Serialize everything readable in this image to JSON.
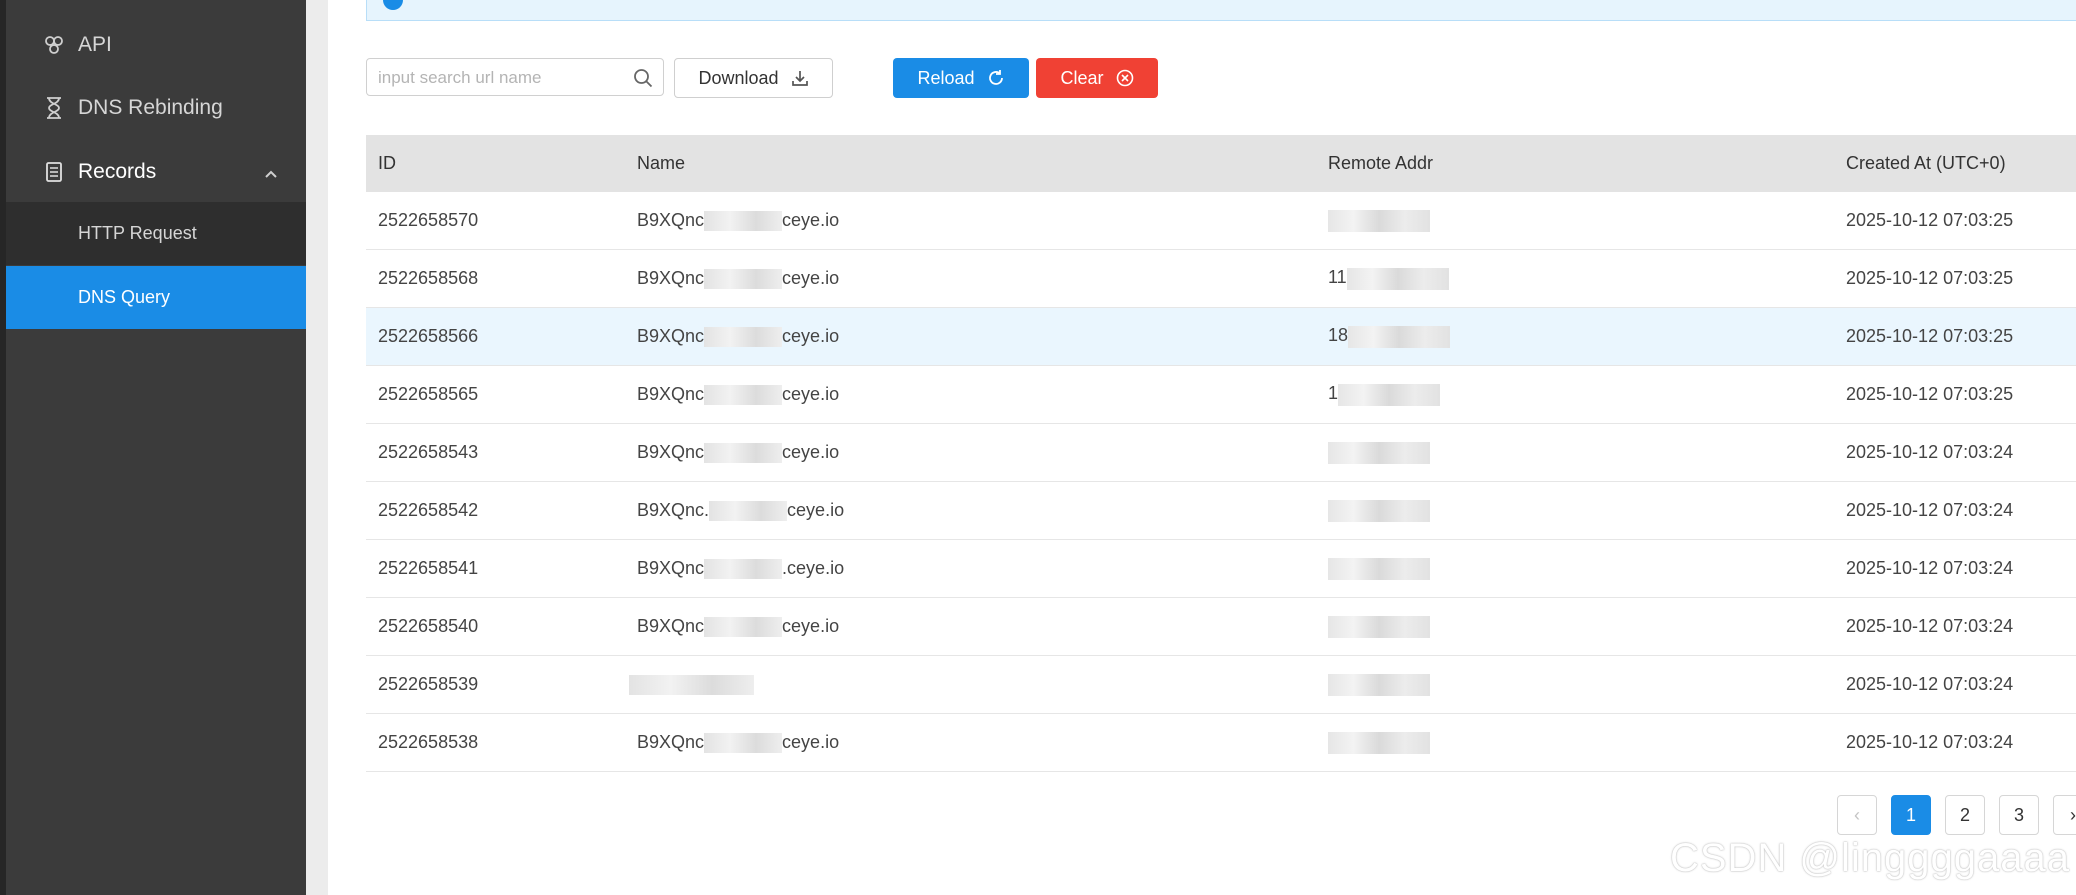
{
  "sidebar": {
    "items": [
      {
        "label": "API",
        "icon": "api-icon"
      },
      {
        "label": "DNS Rebinding",
        "icon": "hourglass-icon"
      },
      {
        "label": "Records",
        "icon": "records-icon",
        "expanded": true
      }
    ],
    "sub_items": [
      {
        "label": "HTTP Request"
      },
      {
        "label": "DNS Query",
        "active": true
      }
    ]
  },
  "toolbar": {
    "search_placeholder": "input search url name",
    "download_label": "Download",
    "reload_label": "Reload",
    "clear_label": "Clear"
  },
  "table": {
    "columns": [
      "ID",
      "Name",
      "Remote Addr",
      "Created At (UTC+0)"
    ],
    "rows": [
      {
        "id": "2522658570",
        "name_prefix": "B9XQnc",
        "name_suffix": "ceye.io",
        "addr": "",
        "created": "2025-10-12 07:03:25"
      },
      {
        "id": "2522658568",
        "name_prefix": "B9XQnc",
        "name_suffix": "ceye.io",
        "addr": "11",
        "created": "2025-10-12 07:03:25"
      },
      {
        "id": "2522658566",
        "name_prefix": "B9XQnc",
        "name_suffix": "ceye.io",
        "addr": "18",
        "created": "2025-10-12 07:03:25"
      },
      {
        "id": "2522658565",
        "name_prefix": "B9XQnc",
        "name_suffix": "ceye.io",
        "addr": "1",
        "created": "2025-10-12 07:03:25"
      },
      {
        "id": "2522658543",
        "name_prefix": "B9XQnc",
        "name_suffix": "ceye.io",
        "addr": "",
        "created": "2025-10-12 07:03:24"
      },
      {
        "id": "2522658542",
        "name_prefix": "B9XQnc.",
        "name_suffix": "ceye.io",
        "addr": "",
        "created": "2025-10-12 07:03:24"
      },
      {
        "id": "2522658541",
        "name_prefix": "B9XQnc",
        "name_suffix": ".ceye.io",
        "addr": "",
        "created": "2025-10-12 07:03:24"
      },
      {
        "id": "2522658540",
        "name_prefix": "B9XQnc",
        "name_suffix": "ceye.io",
        "addr": "",
        "created": "2025-10-12 07:03:24"
      },
      {
        "id": "2522658539",
        "name_prefix": "",
        "name_suffix": "",
        "addr": "",
        "created": "2025-10-12 07:03:24"
      },
      {
        "id": "2522658538",
        "name_prefix": "B9XQnc",
        "name_suffix": "ceye.io",
        "addr": "",
        "created": "2025-10-12 07:03:24"
      }
    ],
    "highlighted_row": 2
  },
  "pagination": {
    "pages": [
      "1",
      "2",
      "3"
    ],
    "current": "1",
    "prev_label": "‹",
    "next_label": "›"
  },
  "watermark": "CSDN @linggggaaaa",
  "colors": {
    "primary": "#1a8ce6",
    "danger": "#f04134",
    "sidebar_bg": "#3b3b3b",
    "active_bg": "#1a8ce6"
  }
}
